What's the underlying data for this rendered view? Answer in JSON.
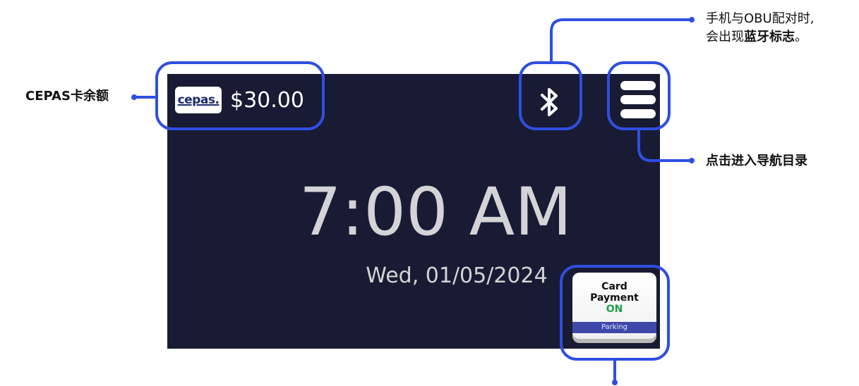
{
  "screen": {
    "card_logo": "cepas.",
    "balance": "$30.00",
    "time": "7:00 AM",
    "date": "Wed, 01/05/2024",
    "payment_button": {
      "line1": "Card",
      "line2": "Payment",
      "status": "ON",
      "tag": "Parking"
    }
  },
  "annotations": {
    "cepas_balance": "CEPAS卡余额",
    "bluetooth_line1": "手机与OBU配对时,",
    "bluetooth_line2_prefix": "会出现",
    "bluetooth_line2_bold": "蓝牙标志",
    "bluetooth_line2_suffix": "。",
    "menu": "点击进入导航目录"
  },
  "icons": [
    "bluetooth-icon",
    "hamburger-menu-icon",
    "cepas-card-logo"
  ],
  "colors": {
    "screen_bg": "#181b33",
    "callout": "#2f4fe0",
    "status_on": "#1fa04a",
    "tag_bg": "#3e48a8"
  }
}
